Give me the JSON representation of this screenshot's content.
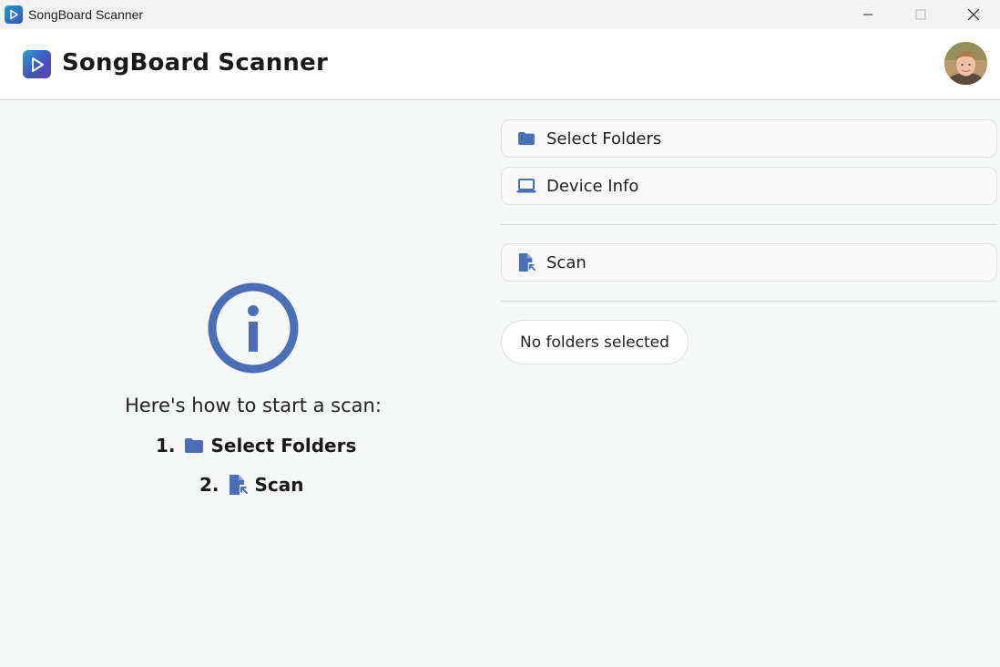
{
  "window": {
    "title": "SongBoard Scanner",
    "controls": [
      "minimize-icon",
      "maximize-icon",
      "close-icon"
    ]
  },
  "header": {
    "title": "SongBoard Scanner",
    "logo_icon": "play-icon",
    "avatar": "user-avatar"
  },
  "instructions": {
    "icon": "info-icon",
    "heading": "Here's how to start a scan:",
    "steps": [
      {
        "number": "1.",
        "icon": "folder-icon",
        "label": "Select Folders"
      },
      {
        "number": "2.",
        "icon": "scan-file-icon",
        "label": "Scan"
      }
    ]
  },
  "panel": {
    "select_folders_label": "Select Folders",
    "device_info_label": "Device Info",
    "scan_label": "Scan",
    "status": "No folders selected"
  },
  "colors": {
    "accent": "#4a6fb8",
    "background": "#f6f7f7",
    "header": "#ffffff"
  }
}
